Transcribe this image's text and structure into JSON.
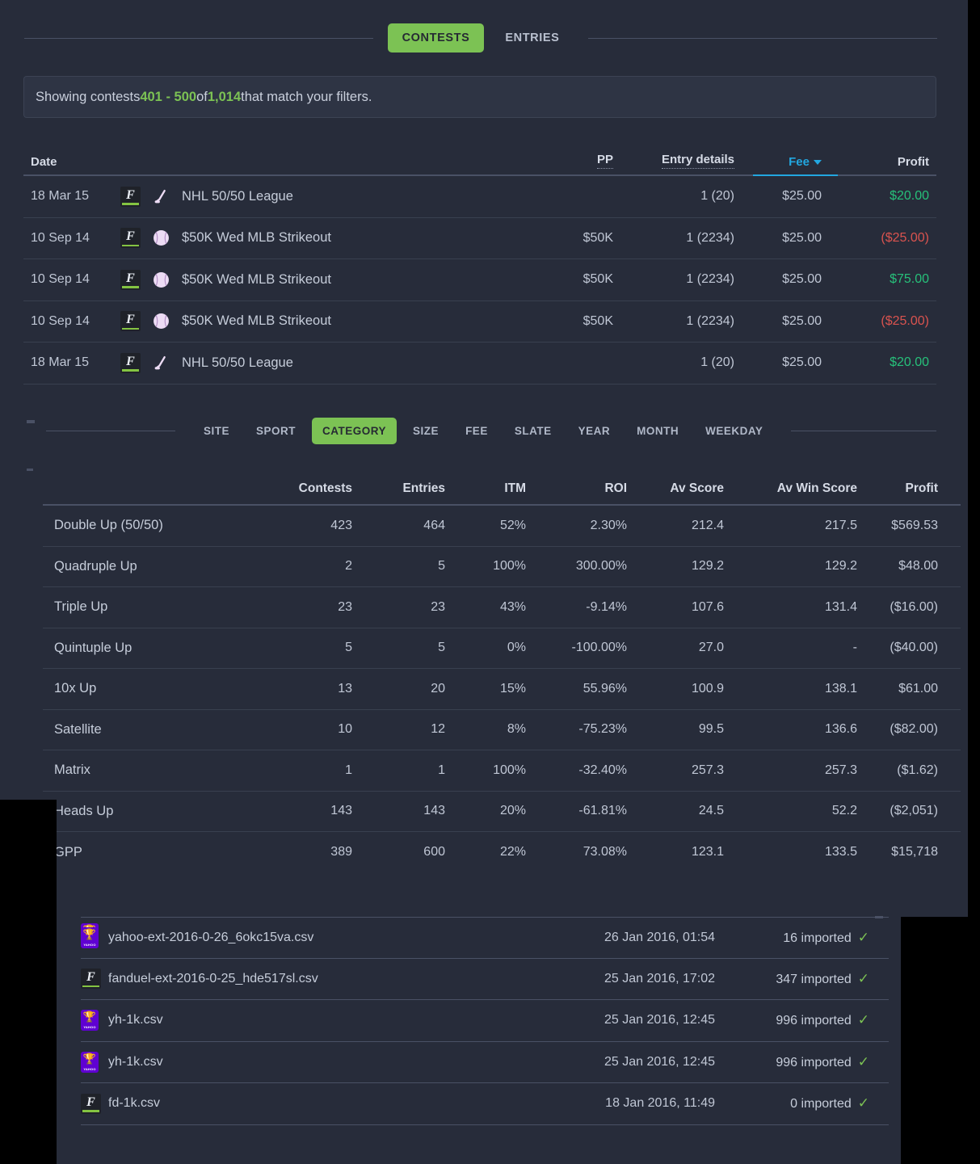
{
  "colors": {
    "background": "#272c3a",
    "accent_green": "#7cc254",
    "profit_green": "#27c07a",
    "loss_red": "#d9534f",
    "link_blue": "#22a7e0",
    "panel": "#2e3444"
  },
  "tabs": [
    {
      "label": "CONTESTS",
      "active": true
    },
    {
      "label": "ENTRIES",
      "active": false
    }
  ],
  "banner": {
    "prefix": "Showing contests ",
    "range": "401 - 500",
    "mid": " of ",
    "total": "1,014",
    "suffix": " that match your filters."
  },
  "contests": {
    "headers": {
      "date": "Date",
      "pp": "PP",
      "entry_details": "Entry details",
      "fee": "Fee",
      "profit": "Profit"
    },
    "sort_column": "Fee",
    "rows": [
      {
        "date": "18 Mar 15",
        "site": "fanduel",
        "sport": "hockey",
        "name": "NHL 50/50 League",
        "pp": "",
        "entry": "1 (20)",
        "fee": "$25.00",
        "profit": "$20.00",
        "profit_sign": "pos"
      },
      {
        "date": "10 Sep 14",
        "site": "fanduel",
        "sport": "baseball",
        "name": "$50K Wed MLB Strikeout",
        "pp": "$50K",
        "entry": "1 (2234)",
        "fee": "$25.00",
        "profit": "($25.00)",
        "profit_sign": "neg"
      },
      {
        "date": "10 Sep 14",
        "site": "fanduel",
        "sport": "baseball",
        "name": "$50K Wed MLB Strikeout",
        "pp": "$50K",
        "entry": "1 (2234)",
        "fee": "$25.00",
        "profit": "$75.00",
        "profit_sign": "pos"
      },
      {
        "date": "10 Sep 14",
        "site": "fanduel",
        "sport": "baseball",
        "name": "$50K Wed MLB Strikeout",
        "pp": "$50K",
        "entry": "1 (2234)",
        "fee": "$25.00",
        "profit": "($25.00)",
        "profit_sign": "neg"
      },
      {
        "date": "18 Mar 15",
        "site": "fanduel",
        "sport": "hockey",
        "name": "NHL 50/50 League",
        "pp": "",
        "entry": "1 (20)",
        "fee": "$25.00",
        "profit": "$20.00",
        "profit_sign": "pos"
      }
    ]
  },
  "filters": [
    {
      "label": "SITE",
      "active": false
    },
    {
      "label": "SPORT",
      "active": false
    },
    {
      "label": "CATEGORY",
      "active": true
    },
    {
      "label": "SIZE",
      "active": false
    },
    {
      "label": "FEE",
      "active": false
    },
    {
      "label": "SLATE",
      "active": false
    },
    {
      "label": "YEAR",
      "active": false
    },
    {
      "label": "MONTH",
      "active": false
    },
    {
      "label": "WEEKDAY",
      "active": false
    }
  ],
  "stats": {
    "headers": {
      "name": "",
      "contests": "Contests",
      "entries": "Entries",
      "itm": "ITM",
      "roi": "ROI",
      "av_score": "Av Score",
      "av_win_score": "Av Win Score",
      "profit": "Profit"
    },
    "rows": [
      {
        "name": "Double Up (50/50)",
        "contests": "423",
        "entries": "464",
        "itm": "52%",
        "roi": "2.30%",
        "av_score": "212.4",
        "av_win_score": "217.5",
        "profit": "$569.53",
        "profit_sign": "pos"
      },
      {
        "name": "Quadruple Up",
        "contests": "2",
        "entries": "5",
        "itm": "100%",
        "roi": "300.00%",
        "av_score": "129.2",
        "av_win_score": "129.2",
        "profit": "$48.00",
        "profit_sign": "pos"
      },
      {
        "name": "Triple Up",
        "contests": "23",
        "entries": "23",
        "itm": "43%",
        "roi": "-9.14%",
        "av_score": "107.6",
        "av_win_score": "131.4",
        "profit": "($16.00)",
        "profit_sign": "neg"
      },
      {
        "name": "Quintuple Up",
        "contests": "5",
        "entries": "5",
        "itm": "0%",
        "roi": "-100.00%",
        "av_score": "27.0",
        "av_win_score": "-",
        "profit": "($40.00)",
        "profit_sign": "neg"
      },
      {
        "name": "10x Up",
        "contests": "13",
        "entries": "20",
        "itm": "15%",
        "roi": "55.96%",
        "av_score": "100.9",
        "av_win_score": "138.1",
        "profit": "$61.00",
        "profit_sign": "pos"
      },
      {
        "name": "Satellite",
        "contests": "10",
        "entries": "12",
        "itm": "8%",
        "roi": "-75.23%",
        "av_score": "99.5",
        "av_win_score": "136.6",
        "profit": "($82.00)",
        "profit_sign": "neg"
      },
      {
        "name": "Matrix",
        "contests": "1",
        "entries": "1",
        "itm": "100%",
        "roi": "-32.40%",
        "av_score": "257.3",
        "av_win_score": "257.3",
        "profit": "($1.62)",
        "profit_sign": "neg"
      },
      {
        "name": "Heads Up",
        "contests": "143",
        "entries": "143",
        "itm": "20%",
        "roi": "-61.81%",
        "av_score": "24.5",
        "av_win_score": "52.2",
        "profit": "($2,051)",
        "profit_sign": "neg"
      },
      {
        "name": "GPP",
        "contests": "389",
        "entries": "600",
        "itm": "22%",
        "roi": "73.08%",
        "av_score": "123.1",
        "av_win_score": "133.5",
        "profit": "$15,718",
        "profit_sign": "pos"
      }
    ]
  },
  "imports": {
    "rows": [
      {
        "site": "yahoo",
        "filename": "yahoo-ext-2016-0-26_6okc15va.csv",
        "date": "26 Jan 2016, 01:54",
        "status": "16 imported",
        "check": "✓"
      },
      {
        "site": "fanduel",
        "filename": "fanduel-ext-2016-0-25_hde517sl.csv",
        "date": "25 Jan 2016, 17:02",
        "status": "347 imported",
        "check": "✓"
      },
      {
        "site": "yahoo",
        "filename": "yh-1k.csv",
        "date": "25 Jan 2016, 12:45",
        "status": "996 imported",
        "check": "✓"
      },
      {
        "site": "yahoo",
        "filename": "yh-1k.csv",
        "date": "25 Jan 2016, 12:45",
        "status": "996 imported",
        "check": "✓"
      },
      {
        "site": "fanduel",
        "filename": "fd-1k.csv",
        "date": "18 Jan 2016, 11:49",
        "status": "0 imported",
        "check": "✓"
      }
    ]
  }
}
